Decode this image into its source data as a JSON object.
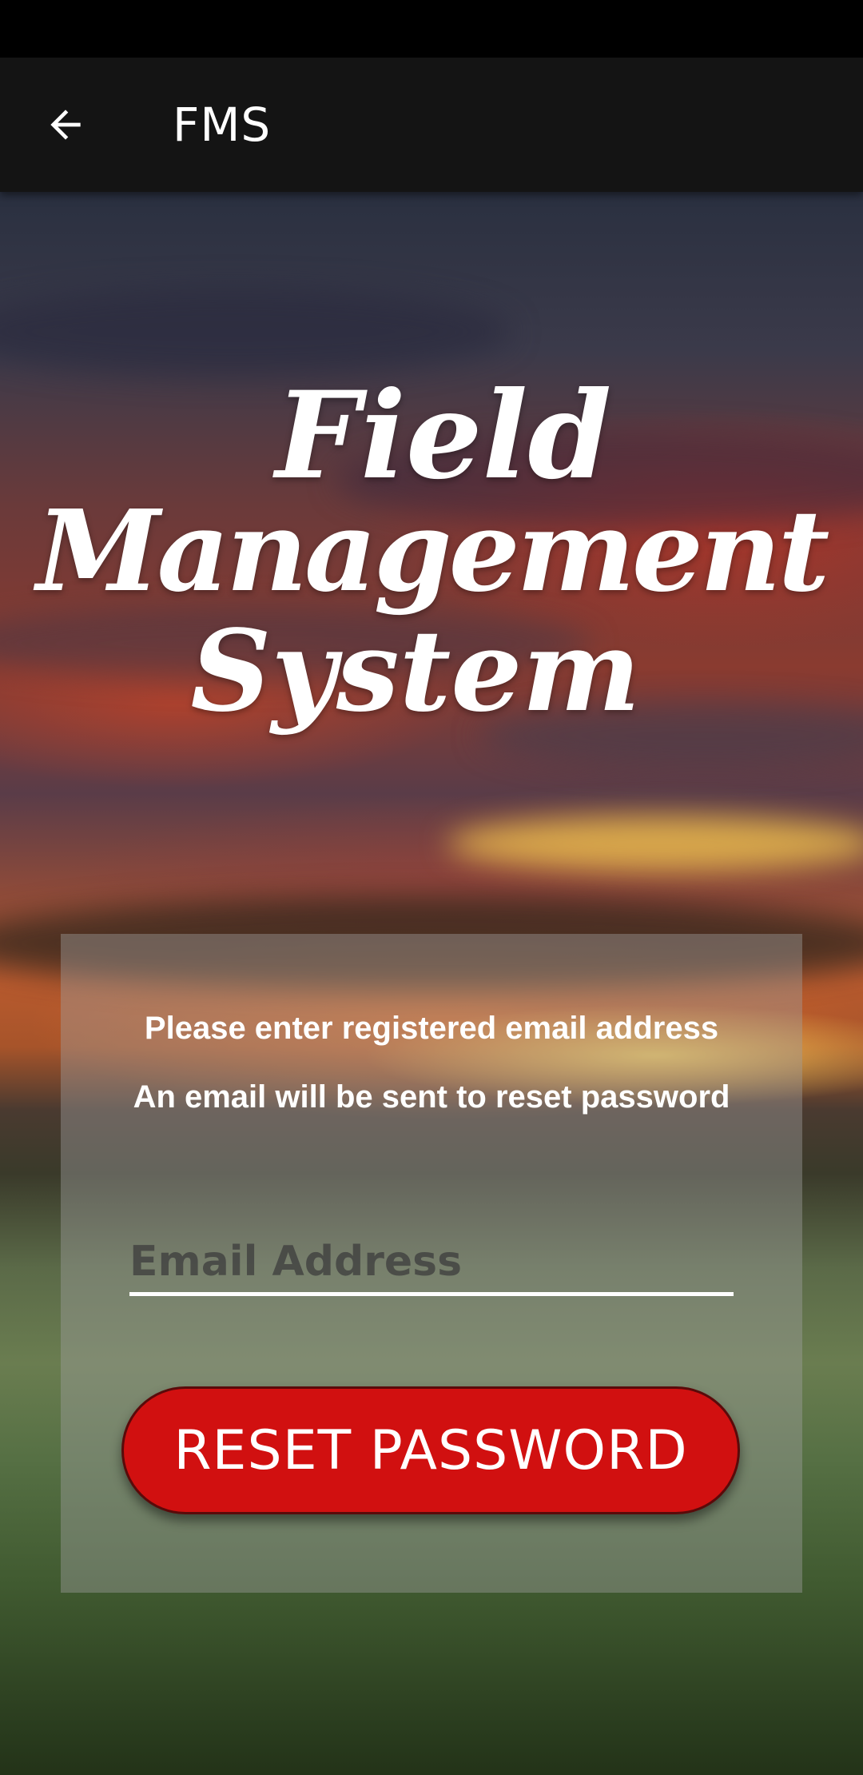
{
  "app_bar": {
    "back_icon": "arrow-left-icon",
    "title": "FMS"
  },
  "logo": {
    "line1": "Field",
    "line2": "Management",
    "line3": "System"
  },
  "reset_form": {
    "instruction_1": "Please enter registered email address",
    "instruction_2": "An email will be sent to reset password",
    "email_placeholder": "Email Address",
    "email_value": "",
    "button_label": "RESET PASSWORD"
  },
  "colors": {
    "app_bar": "#141414",
    "button": "#d11010",
    "text": "#ffffff"
  }
}
